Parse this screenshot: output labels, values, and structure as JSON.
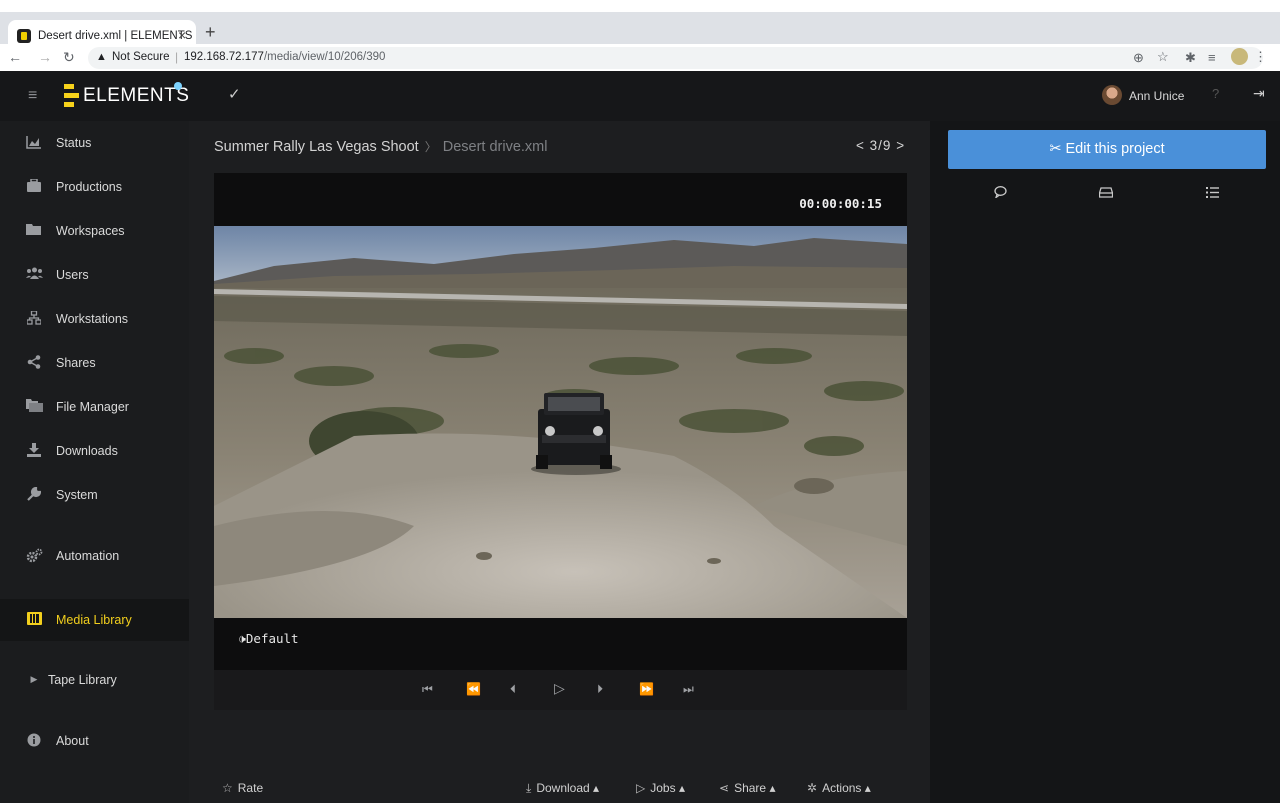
{
  "browser": {
    "tab_title": "Desert drive.xml | ELEMENTS",
    "tab_close": "×",
    "new_tab": "+",
    "security_label": "Not Secure",
    "url_host": "192.168.72.177",
    "url_path": "/media/view/10/206/390"
  },
  "app": {
    "brand": "ELEMENTS",
    "user_name": "Ann Unice"
  },
  "sidebar": {
    "items": [
      {
        "label": "Status",
        "icon": "chart-icon"
      },
      {
        "label": "Productions",
        "icon": "briefcase-icon"
      },
      {
        "label": "Workspaces",
        "icon": "folder-icon"
      },
      {
        "label": "Users",
        "icon": "users-icon"
      },
      {
        "label": "Workstations",
        "icon": "network-icon"
      },
      {
        "label": "Shares",
        "icon": "share-icon"
      },
      {
        "label": "File Manager",
        "icon": "folders-icon"
      },
      {
        "label": "Downloads",
        "icon": "download-icon"
      },
      {
        "label": "System",
        "icon": "wrench-icon"
      },
      {
        "label": "Automation",
        "icon": "gears-icon"
      },
      {
        "label": "Media Library",
        "icon": "film-icon"
      },
      {
        "label": "Tape Library",
        "icon": "caret-right-icon"
      },
      {
        "label": "About",
        "icon": "info-icon"
      }
    ],
    "active": "Media Library"
  },
  "breadcrumb": {
    "production": "Summer Rally Las Vegas Shoot",
    "separator": "〉",
    "file": "Desert drive.xml"
  },
  "pager": {
    "prev": "<",
    "text": "3/9",
    "next": ">"
  },
  "player": {
    "timecode": "00:00:00:15",
    "audio_track": "Default",
    "audio_icon": "🕩"
  },
  "bottom_actions": {
    "rate": "Rate",
    "download": "Download",
    "jobs": "Jobs",
    "share": "Share",
    "actions": "Actions"
  },
  "right_panel": {
    "edit_label": "Edit this project",
    "tabs": [
      "comments-icon",
      "drive-icon",
      "list-icon"
    ]
  },
  "colors": {
    "accent_yellow": "#f2cf1d",
    "button_blue": "#4a90d9",
    "sidebar_bg": "#1b1c1e",
    "main_bg": "#1d1e20"
  }
}
